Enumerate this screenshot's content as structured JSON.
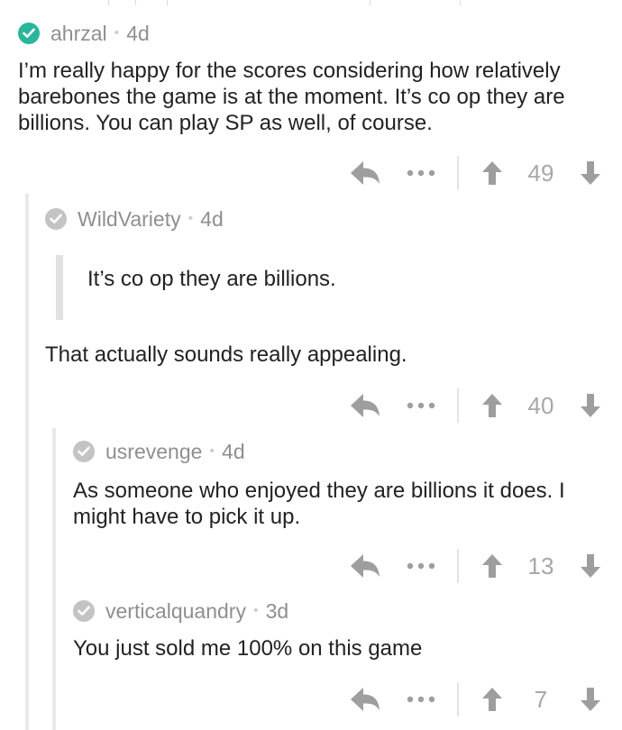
{
  "colors": {
    "op_check": "#29b69b",
    "user_check": "#c4c4c4",
    "meta_text": "#8f8f8f",
    "icon_gray": "#9e9e9e",
    "score_text": "#a8a8a8"
  },
  "comments": [
    {
      "author": "ahrzal",
      "age": "4d",
      "body": "I’m really happy for the scores considering how relatively barebones the game is at the moment. It’s co op they are billions. You can play SP as well, of course.",
      "score": "49"
    },
    {
      "author": "WildVariety",
      "age": "4d",
      "quote": "It’s co op they are billions.",
      "body": "That actually sounds really appealing.",
      "score": "40"
    },
    {
      "author": "usrevenge",
      "age": "4d",
      "body": "As someone who enjoyed they are billions it does. I might have to pick it up.",
      "score": "13"
    },
    {
      "author": "verticalquandry",
      "age": "3d",
      "body": "You just sold me 100% on this game",
      "score": "7"
    }
  ],
  "icons": {
    "author_check": "check-circle-icon",
    "reply": "reply-arrow-icon",
    "more": "more-dots-icon",
    "upvote": "upvote-arrow-icon",
    "downvote": "downvote-arrow-icon"
  }
}
